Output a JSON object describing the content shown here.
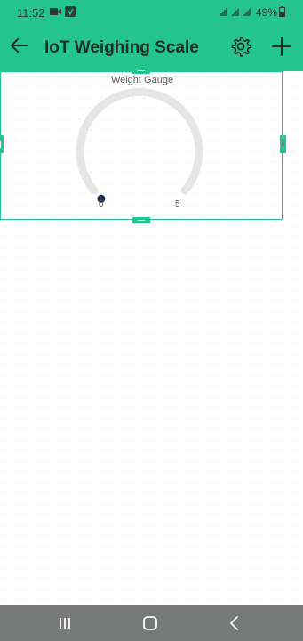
{
  "status_bar": {
    "time": "11:52",
    "battery_percent": "49%",
    "icons": [
      "video-camera-icon",
      "v-app-icon",
      "signal-icon",
      "battery-icon"
    ]
  },
  "app_bar": {
    "title": "IoT Weighing Scale",
    "icons": [
      "back-arrow-icon",
      "gear-icon",
      "plus-icon"
    ]
  },
  "widget": {
    "label": "Weight Gauge",
    "min_label": "0",
    "max_label": "5",
    "value_fraction": 0
  },
  "colors": {
    "accent": "#23c48e",
    "gauge_track": "#e6e6e6",
    "gauge_indicator": "#1f2a55",
    "navbar": "#777978"
  },
  "nav_bar": {
    "icons": [
      "recent-apps-icon",
      "home-icon",
      "back-icon"
    ]
  }
}
